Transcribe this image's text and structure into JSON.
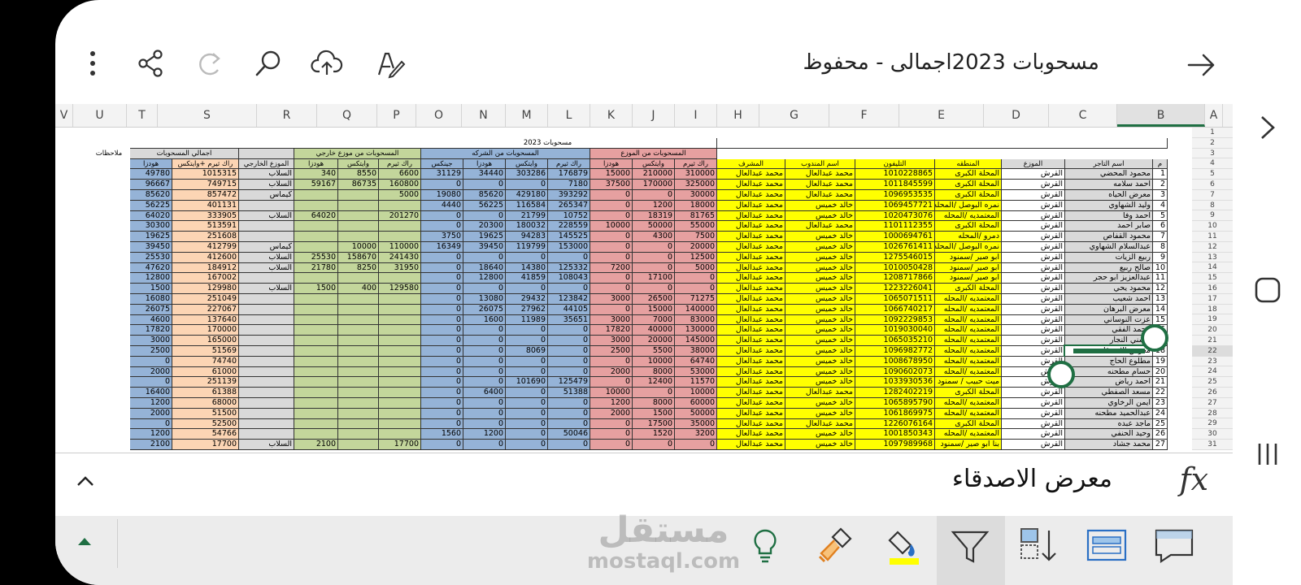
{
  "title": "مسحوبات 2023اجمالى - محفوظ",
  "formula_bar": {
    "value": "معرض الاصدقاء",
    "fx": "fx"
  },
  "watermark": {
    "main": "مستقل",
    "sub": "mostaql.com"
  },
  "columns": [
    "V",
    "U",
    "T",
    "S",
    "R",
    "Q",
    "P",
    "O",
    "N",
    "M",
    "L",
    "K",
    "J",
    "I",
    "H",
    "G",
    "F",
    "E",
    "D",
    "C",
    "B",
    "A"
  ],
  "sheet": {
    "title": "مسحوبات 2023",
    "groups": {
      "distributor": "المسحوبات من الموزع",
      "company": "المسحوبات من الشركه",
      "external": "المسحوبات من موزع خارجي",
      "total": "اجمالي المسحوبات",
      "notes": "ملاحظات"
    },
    "headers": [
      "م",
      "اسم التاجر",
      "الموزع",
      "المنطقه",
      "التليفون",
      "اسم المندوب",
      "المشرف",
      "راك ثيرم",
      "وايتكس",
      "هودزا",
      "راك ثيرم",
      "وايتكس",
      "هودزا",
      "جينكس",
      "راك ثيرم",
      "وايتكس",
      "هودزا",
      "الموزع الخارجي",
      "راك ثيرم +وايتكس",
      "هودزا"
    ],
    "rows": [
      {
        "n": "1",
        "name": "محمود المحضي",
        "dist": "القرش",
        "area": "المحلة الكبرى",
        "phone": "1010228865",
        "rep": "محمد عبدالعال",
        "sup": "محمد عبدالعال",
        "d1": "310000",
        "d2": "210000",
        "d3": "15000",
        "c1": "176879",
        "c2": "303286",
        "c3": "34440",
        "c4": "31129",
        "e1": "6600",
        "e2": "8550",
        "e3": "340",
        "ext": "السلاب",
        "t1": "1015315",
        "t2": "49780"
      },
      {
        "n": "2",
        "name": "احمد سلامه",
        "dist": "القرش",
        "area": "المحلة الكبرى",
        "phone": "1011845599",
        "rep": "محمد عبدالعال",
        "sup": "محمد عبدالعال",
        "d1": "325000",
        "d2": "170000",
        "d3": "37500",
        "c1": "7180",
        "c2": "0",
        "c3": "0",
        "c4": "0",
        "e1": "160800",
        "e2": "86735",
        "e3": "59167",
        "ext": "السلاب",
        "t1": "749715",
        "t2": "96667"
      },
      {
        "n": "3",
        "name": "معرض الحياه",
        "dist": "القرش",
        "area": "المحلة الكبرى",
        "phone": "1096953535",
        "rep": "محمد عبدالعال",
        "sup": "محمد عبدالعال",
        "d1": "30000",
        "d2": "0",
        "d3": "0",
        "c1": "393292",
        "c2": "429180",
        "c3": "85620",
        "c4": "19080",
        "e1": "5000",
        "e2": "",
        "e3": "",
        "ext": "كيماس",
        "t1": "857472",
        "t2": "85620"
      },
      {
        "n": "4",
        "name": "وليد الشهاوي",
        "dist": "القرش",
        "area": "نمره البوصل /المحله",
        "phone": "1069457721",
        "rep": "خالد خميس",
        "sup": "محمد عبدالعال",
        "d1": "18000",
        "d2": "1200",
        "d3": "0",
        "c1": "265347",
        "c2": "116584",
        "c3": "56225",
        "c4": "4440",
        "e1": "",
        "e2": "",
        "e3": "",
        "ext": "",
        "t1": "401131",
        "t2": "56225"
      },
      {
        "n": "5",
        "name": "احمد وفا",
        "dist": "القرش",
        "area": "المعتمديه /المحله",
        "phone": "1020473076",
        "rep": "خالد خميس",
        "sup": "محمد عبدالعال",
        "d1": "81765",
        "d2": "18319",
        "d3": "0",
        "c1": "10752",
        "c2": "21799",
        "c3": "0",
        "c4": "0",
        "e1": "201270",
        "e2": "",
        "e3": "64020",
        "ext": "السلاب",
        "t1": "333905",
        "t2": "64020"
      },
      {
        "n": "6",
        "name": "صابر احمد",
        "dist": "القرش",
        "area": "المحلة الكبرى",
        "phone": "1101112355",
        "rep": "محمد عبدالعال",
        "sup": "محمد عبدالعال",
        "d1": "55000",
        "d2": "50000",
        "d3": "10000",
        "c1": "228559",
        "c2": "180032",
        "c3": "20300",
        "c4": "0",
        "e1": "",
        "e2": "",
        "e3": "",
        "ext": "",
        "t1": "513591",
        "t2": "30300"
      },
      {
        "n": "7",
        "name": "محمود القفاص",
        "dist": "القرش",
        "area": "دمرو /المحله",
        "phone": "1000694761",
        "rep": "خالد خميس",
        "sup": "محمد عبدالعال",
        "d1": "7500",
        "d2": "4300",
        "d3": "0",
        "c1": "145525",
        "c2": "94283",
        "c3": "19625",
        "c4": "3750",
        "e1": "",
        "e2": "",
        "e3": "",
        "ext": "",
        "t1": "251608",
        "t2": "19625"
      },
      {
        "n": "8",
        "name": "عبدالسلام الشهاوي",
        "dist": "القرش",
        "area": "نمره البوصل /المحله",
        "phone": "1026761411",
        "rep": "خالد خميس",
        "sup": "محمد عبدالعال",
        "d1": "20000",
        "d2": "0",
        "d3": "0",
        "c1": "153000",
        "c2": "119799",
        "c3": "39450",
        "c4": "16349",
        "e1": "110000",
        "e2": "10000",
        "e3": "",
        "ext": "كيماس",
        "t1": "412799",
        "t2": "39450"
      },
      {
        "n": "9",
        "name": "ربيع الزيات",
        "dist": "القرش",
        "area": "ابو صير /سمنود",
        "phone": "1275546015",
        "rep": "خالد خميس",
        "sup": "محمد عبدالعال",
        "d1": "12500",
        "d2": "0",
        "d3": "0",
        "c1": "0",
        "c2": "0",
        "c3": "0",
        "c4": "0",
        "e1": "241430",
        "e2": "158670",
        "e3": "25530",
        "ext": "السلاب",
        "t1": "412600",
        "t2": "25530"
      },
      {
        "n": "10",
        "name": "صالح ربيع",
        "dist": "القرش",
        "area": "ابو صير /سمنود",
        "phone": "1010050428",
        "rep": "خالد خميس",
        "sup": "محمد عبدالعال",
        "d1": "5000",
        "d2": "0",
        "d3": "7200",
        "c1": "125332",
        "c2": "14380",
        "c3": "18640",
        "c4": "0",
        "e1": "31950",
        "e2": "8250",
        "e3": "21780",
        "ext": "السلاب",
        "t1": "184912",
        "t2": "47620"
      },
      {
        "n": "11",
        "name": "عبدالعزيز ابو حجر",
        "dist": "القرش",
        "area": "ابو صير /سمنود",
        "phone": "1208717866",
        "rep": "خالد خميس",
        "sup": "محمد عبدالعال",
        "d1": "0",
        "d2": "17100",
        "d3": "0",
        "c1": "108043",
        "c2": "41859",
        "c3": "12800",
        "c4": "0",
        "e1": "",
        "e2": "",
        "e3": "",
        "ext": "",
        "t1": "167002",
        "t2": "12800"
      },
      {
        "n": "12",
        "name": "محمود يحي",
        "dist": "القرش",
        "area": "المحلة الكبرى",
        "phone": "1223226041",
        "rep": "خالد خميس",
        "sup": "محمد عبدالعال",
        "d1": "0",
        "d2": "0",
        "d3": "0",
        "c1": "0",
        "c2": "0",
        "c3": "0",
        "c4": "0",
        "e1": "129580",
        "e2": "400",
        "e3": "1500",
        "ext": "السلاب",
        "t1": "129980",
        "t2": "1500"
      },
      {
        "n": "13",
        "name": "احمد شعيب",
        "dist": "القرش",
        "area": "المعتمديه /المحله",
        "phone": "1065071511",
        "rep": "خالد خميس",
        "sup": "محمد عبدالعال",
        "d1": "71275",
        "d2": "26500",
        "d3": "3000",
        "c1": "123842",
        "c2": "29432",
        "c3": "13080",
        "c4": "0",
        "e1": "",
        "e2": "",
        "e3": "",
        "ext": "",
        "t1": "251049",
        "t2": "16080"
      },
      {
        "n": "14",
        "name": "معرض البرهان",
        "dist": "القرش",
        "area": "المعتمديه /المحله",
        "phone": "1066740217",
        "rep": "خالد خميس",
        "sup": "محمد عبدالعال",
        "d1": "140000",
        "d2": "15000",
        "d3": "0",
        "c1": "44105",
        "c2": "27962",
        "c3": "26075",
        "c4": "0",
        "e1": "",
        "e2": "",
        "e3": "",
        "ext": "",
        "t1": "227067",
        "t2": "26075"
      },
      {
        "n": "15",
        "name": "عزت النوساني",
        "dist": "القرش",
        "area": "المعتمديه /المحله",
        "phone": "1092229853",
        "rep": "خالد خميس",
        "sup": "محمد عبدالعال",
        "d1": "83000",
        "d2": "7000",
        "d3": "3000",
        "c1": "35651",
        "c2": "11989",
        "c3": "1600",
        "c4": "0",
        "e1": "",
        "e2": "",
        "e3": "",
        "ext": "",
        "t1": "137640",
        "t2": "4600"
      },
      {
        "n": "16",
        "name": "محمد الفقي",
        "dist": "القرش",
        "area": "المعتمديه /المحله",
        "phone": "1019030040",
        "rep": "خالد خميس",
        "sup": "محمد عبدالعال",
        "d1": "130000",
        "d2": "40000",
        "d3": "17820",
        "c1": "0",
        "c2": "0",
        "c3": "0",
        "c4": "0",
        "e1": "",
        "e2": "",
        "e3": "",
        "ext": "",
        "t1": "170000",
        "t2": "17820"
      },
      {
        "n": "17",
        "name": "حسني النجار",
        "dist": "القرش",
        "area": "المعتمديه /المحله",
        "phone": "1065035210",
        "rep": "خالد خميس",
        "sup": "محمد عبدالعال",
        "d1": "145000",
        "d2": "20000",
        "d3": "3000",
        "c1": "0",
        "c2": "0",
        "c3": "0",
        "c4": "0",
        "e1": "",
        "e2": "",
        "e3": "",
        "ext": "",
        "t1": "165000",
        "t2": "3000"
      },
      {
        "n": "18",
        "name": "معرض الاصدقاء",
        "dist": "القرش",
        "area": "المعتمديه /المحله",
        "phone": "1096982772",
        "rep": "خالد خميس",
        "sup": "محمد عبدالعال",
        "d1": "38000",
        "d2": "5500",
        "d3": "2500",
        "c1": "0",
        "c2": "8069",
        "c3": "0",
        "c4": "0",
        "e1": "",
        "e2": "",
        "e3": "",
        "ext": "",
        "t1": "51569",
        "t2": "2500"
      },
      {
        "n": "19",
        "name": "مطلوع الحاج",
        "dist": "القرش",
        "area": "المعتمديه /المحله",
        "phone": "1008678950",
        "rep": "خالد خميس",
        "sup": "محمد عبدالعال",
        "d1": "64740",
        "d2": "10000",
        "d3": "0",
        "c1": "0",
        "c2": "0",
        "c3": "0",
        "c4": "0",
        "e1": "",
        "e2": "",
        "e3": "",
        "ext": "",
        "t1": "74740",
        "t2": "0"
      },
      {
        "n": "20",
        "name": "حسام مطحنه",
        "dist": "القرش",
        "area": "المعتمديه /المحله",
        "phone": "1090602073",
        "rep": "خالد خميس",
        "sup": "محمد عبدالعال",
        "d1": "53000",
        "d2": "8000",
        "d3": "2000",
        "c1": "0",
        "c2": "0",
        "c3": "0",
        "c4": "0",
        "e1": "",
        "e2": "",
        "e3": "",
        "ext": "",
        "t1": "61000",
        "t2": "2000"
      },
      {
        "n": "21",
        "name": "احمد رياض",
        "dist": "القرش",
        "area": "ميت حبيب / سمنود",
        "phone": "1033930536",
        "rep": "خالد خميس",
        "sup": "محمد عبدالعال",
        "d1": "11570",
        "d2": "12400",
        "d3": "0",
        "c1": "125479",
        "c2": "101690",
        "c3": "0",
        "c4": "0",
        "e1": "",
        "e2": "",
        "e3": "",
        "ext": "",
        "t1": "251139",
        "t2": "0"
      },
      {
        "n": "22",
        "name": "مسعد الصفطي",
        "dist": "القرش",
        "area": "المحلة الكبرى",
        "phone": "1282402219",
        "rep": "محمد عبدالعال",
        "sup": "محمد عبدالعال",
        "d1": "10000",
        "d2": "0",
        "d3": "10000",
        "c1": "51388",
        "c2": "0",
        "c3": "6400",
        "c4": "0",
        "e1": "",
        "e2": "",
        "e3": "",
        "ext": "",
        "t1": "61388",
        "t2": "16400"
      },
      {
        "n": "23",
        "name": "ايمن الرخاوي",
        "dist": "القرش",
        "area": "المعتمديه /المحله",
        "phone": "1065895790",
        "rep": "خالد خميس",
        "sup": "محمد عبدالعال",
        "d1": "60000",
        "d2": "8000",
        "d3": "1200",
        "c1": "0",
        "c2": "0",
        "c3": "0",
        "c4": "0",
        "e1": "",
        "e2": "",
        "e3": "",
        "ext": "",
        "t1": "68000",
        "t2": "1200"
      },
      {
        "n": "24",
        "name": "عبدالحميد مطحنه",
        "dist": "القرش",
        "area": "المعتمديه /المحله",
        "phone": "1061869975",
        "rep": "خالد خميس",
        "sup": "محمد عبدالعال",
        "d1": "50000",
        "d2": "1500",
        "d3": "2000",
        "c1": "0",
        "c2": "0",
        "c3": "0",
        "c4": "0",
        "e1": "",
        "e2": "",
        "e3": "",
        "ext": "",
        "t1": "51500",
        "t2": "2000"
      },
      {
        "n": "25",
        "name": "ماجد عبده",
        "dist": "القرش",
        "area": "المحلة الكبرى",
        "phone": "1226076164",
        "rep": "محمد عبدالعال",
        "sup": "محمد عبدالعال",
        "d1": "35000",
        "d2": "17500",
        "d3": "0",
        "c1": "0",
        "c2": "0",
        "c3": "0",
        "c4": "0",
        "e1": "",
        "e2": "",
        "e3": "",
        "ext": "",
        "t1": "52500",
        "t2": "0"
      },
      {
        "n": "26",
        "name": "وحيد الحنفي",
        "dist": "القرش",
        "area": "المعتمديه /المحله",
        "phone": "1001850343",
        "rep": "خالد خميس",
        "sup": "محمد عبدالعال",
        "d1": "3200",
        "d2": "1520",
        "d3": "0",
        "c1": "50046",
        "c2": "0",
        "c3": "1200",
        "c4": "1560",
        "e1": "",
        "e2": "",
        "e3": "",
        "ext": "",
        "t1": "54766",
        "t2": "1200"
      },
      {
        "n": "27",
        "name": "محمد جشاد",
        "dist": "القرش",
        "area": "بنا ابو صير /سمنود",
        "phone": "1097989968",
        "rep": "خالد خميس",
        "sup": "محمد عبدالعال",
        "d1": "0",
        "d2": "0",
        "d3": "0",
        "c1": "0",
        "c2": "0",
        "c3": "0",
        "c4": "0",
        "e1": "17700",
        "e2": "",
        "e3": "2100",
        "ext": "السلاب",
        "t1": "17700",
        "t2": "2100"
      }
    ],
    "rownums": [
      "1",
      "2",
      "3",
      "4",
      "5",
      "6",
      "7",
      "8",
      "9",
      "10",
      "11",
      "12",
      "13",
      "14",
      "15",
      "16",
      "17",
      "18",
      "19",
      "20",
      "21",
      "22",
      "23",
      "24",
      "25",
      "26",
      "27",
      "28",
      "29",
      "30",
      "31"
    ]
  },
  "colors": {
    "yellow": "#ffff00",
    "red": "#e6a0a0",
    "blue": "#95b3d7",
    "green": "#c3d69b",
    "gray": "#d9d9d9",
    "orange": "#fcd5b4",
    "accent": "#1f6f43"
  }
}
